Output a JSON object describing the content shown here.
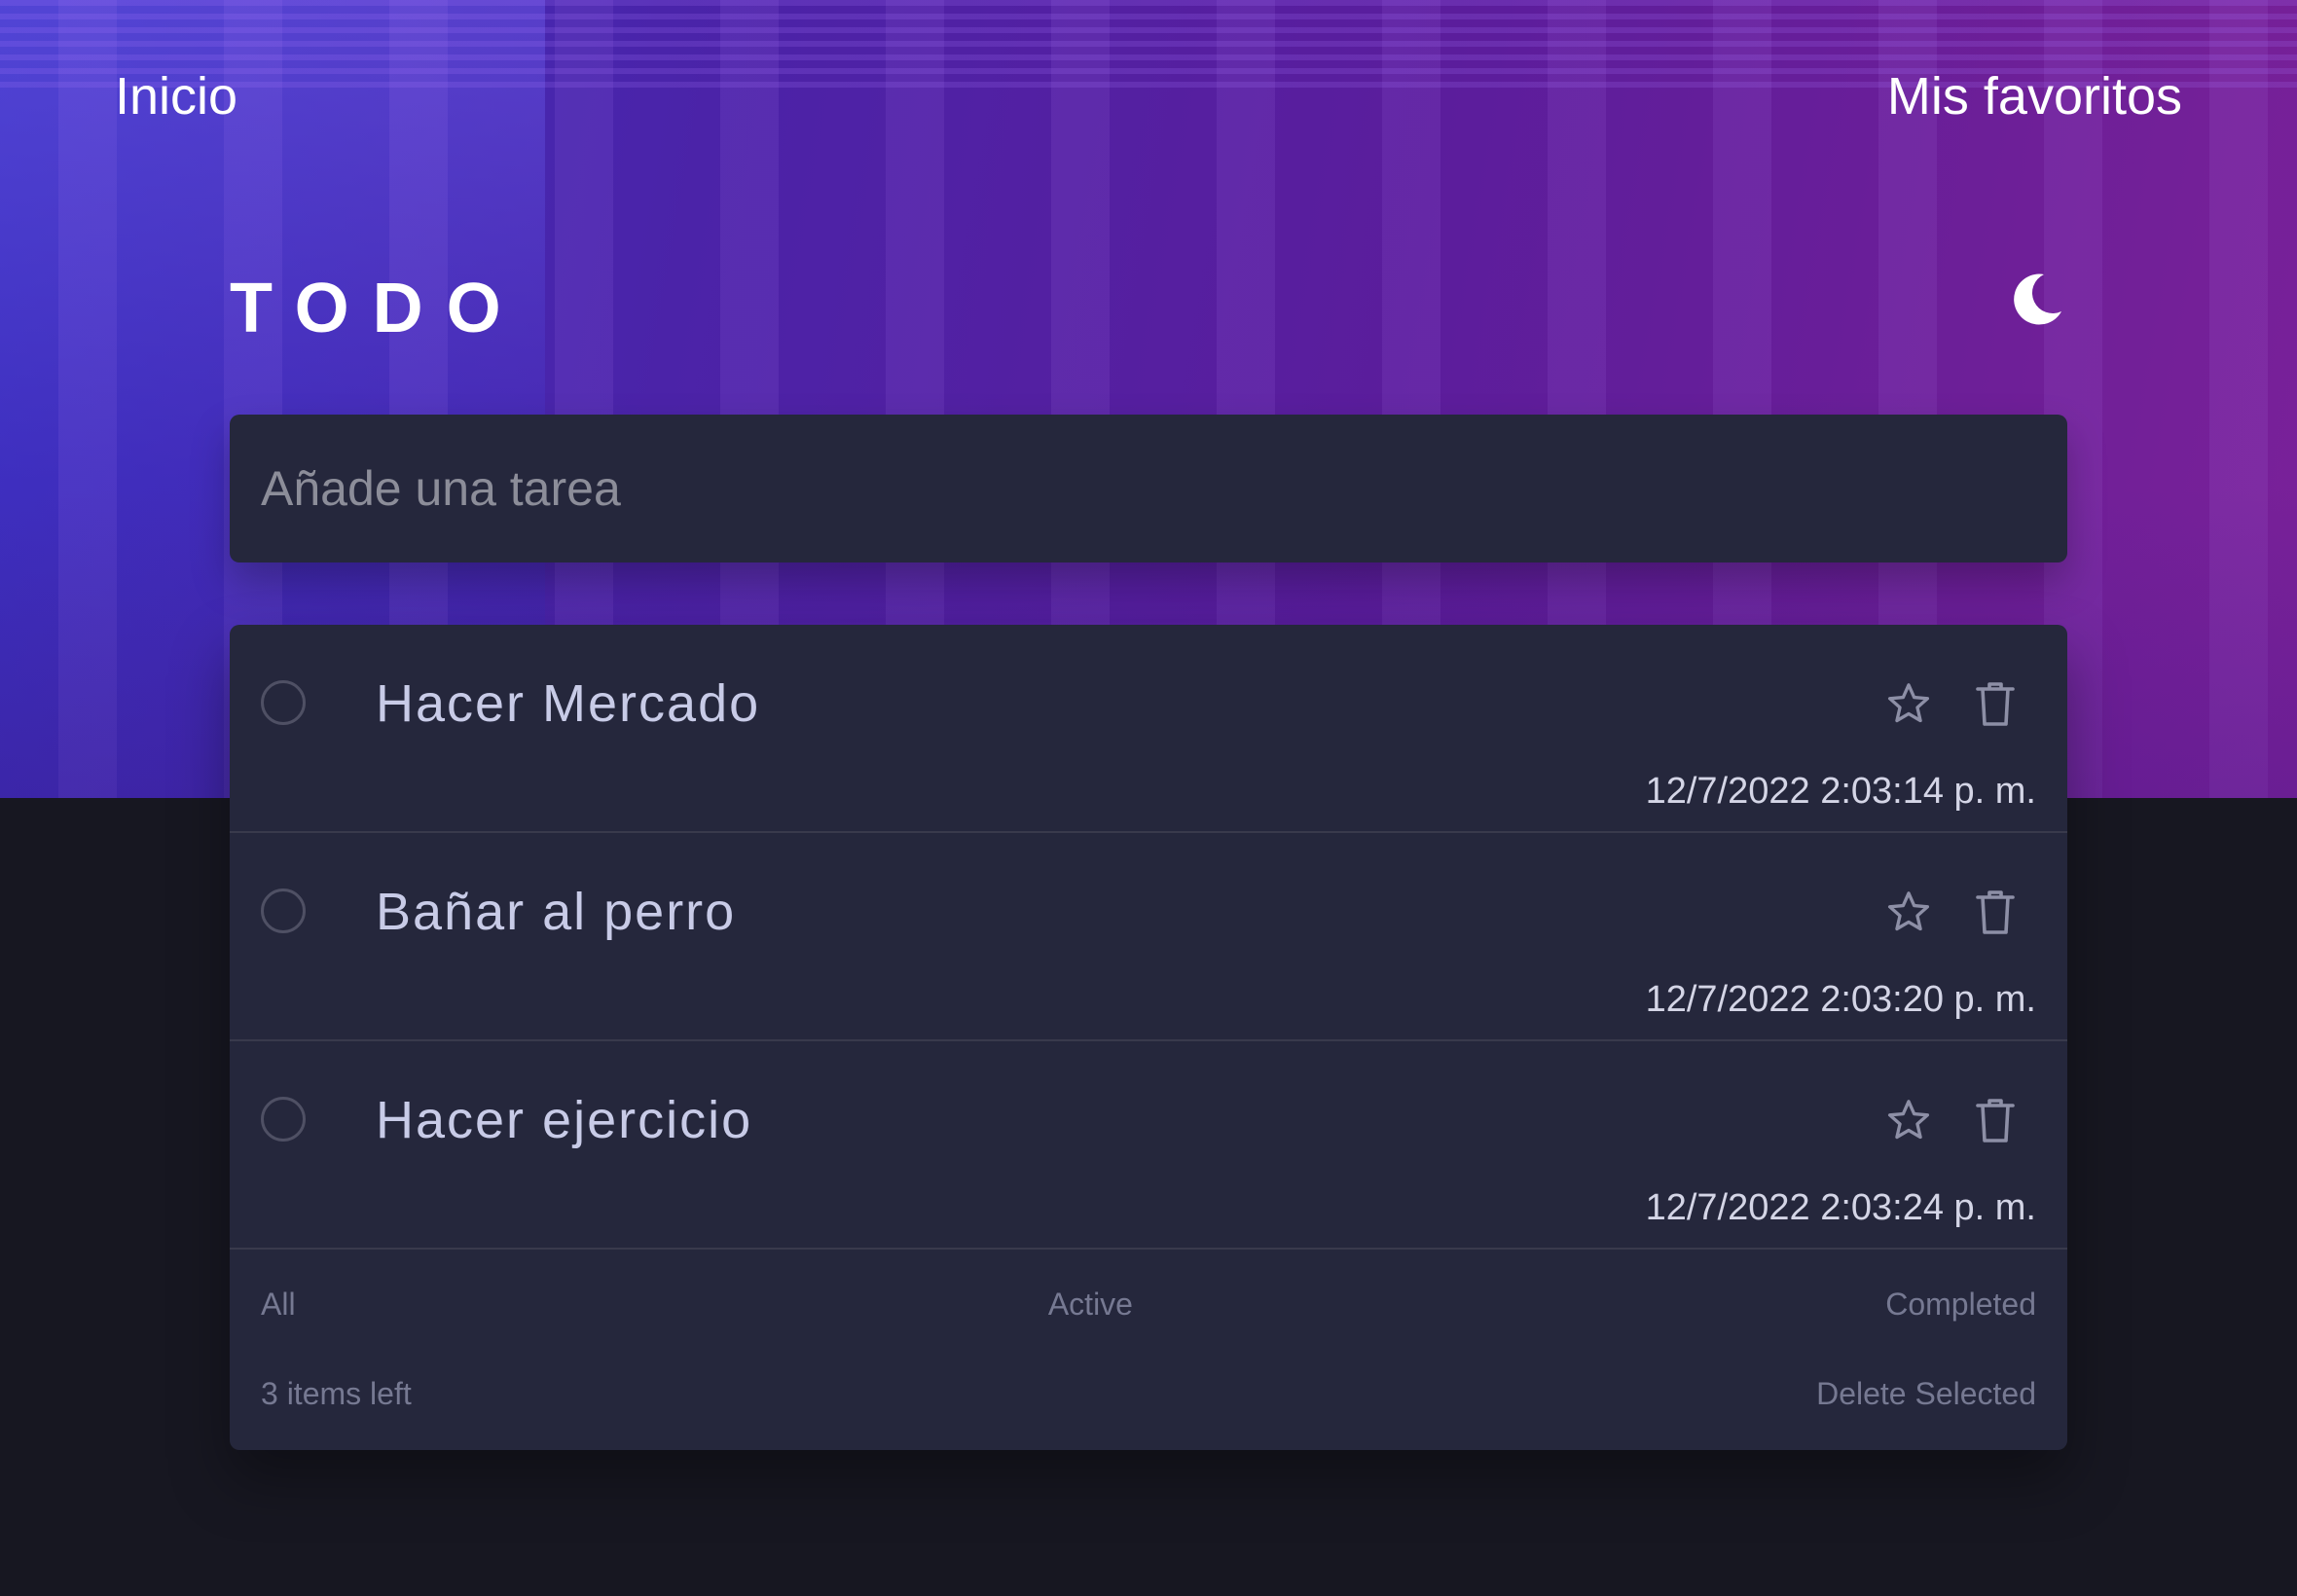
{
  "nav": {
    "home_label": "Inicio",
    "favorites_label": "Mis favoritos"
  },
  "header": {
    "title": "TODO",
    "theme_icon": "moon-icon"
  },
  "new_task": {
    "placeholder": "Añade una tarea",
    "value": ""
  },
  "todos": [
    {
      "text": "Hacer Mercado",
      "date": "12/7/2022 2:03:14 p. m.",
      "completed": false,
      "favorite": false
    },
    {
      "text": "Bañar al perro",
      "date": "12/7/2022 2:03:20 p. m.",
      "completed": false,
      "favorite": false
    },
    {
      "text": "Hacer ejercicio",
      "date": "12/7/2022 2:03:24 p. m.",
      "completed": false,
      "favorite": false
    }
  ],
  "filters": {
    "all": "All",
    "active": "Active",
    "completed": "Completed"
  },
  "footer": {
    "items_left": "3 items left",
    "delete_selected": "Delete Selected"
  },
  "colors": {
    "card_bg": "#25273c",
    "page_bg": "#171721",
    "text": "#c8cbe7",
    "muted": "#767992",
    "hero_start": "#3d2fbf",
    "hero_end": "#7a2199"
  }
}
